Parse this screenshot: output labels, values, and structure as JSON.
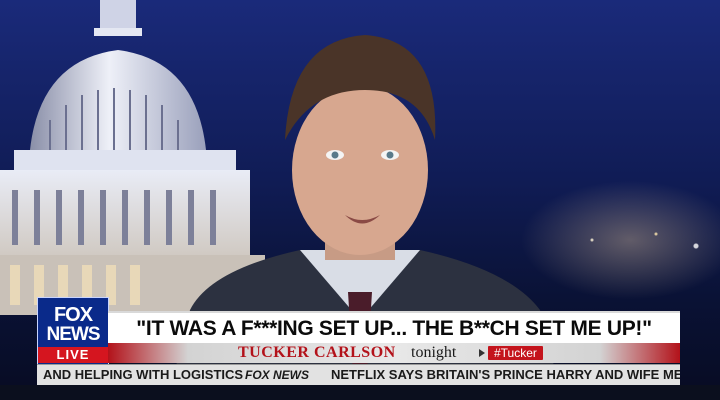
{
  "network": {
    "logo_line1": "FOX",
    "logo_line2": "NEWS",
    "live_badge": "LIVE"
  },
  "headline": {
    "text": "\"IT WAS A F***ING SET UP... THE B**CH SET ME UP!\""
  },
  "show": {
    "name": "TUCKER CARLSON",
    "time": "tonight",
    "hashtag": "#Tucker"
  },
  "ticker": {
    "left_text": "AND HELPING WITH LOGISTICS",
    "brand": "FOX NEWS",
    "right_text": "NETFLIX SAYS BRITAIN'S PRINCE HARRY AND WIFE MEGHA"
  },
  "colors": {
    "fox_blue": "#0a2a8a",
    "live_red": "#d5151f",
    "show_red": "#b3121a"
  }
}
